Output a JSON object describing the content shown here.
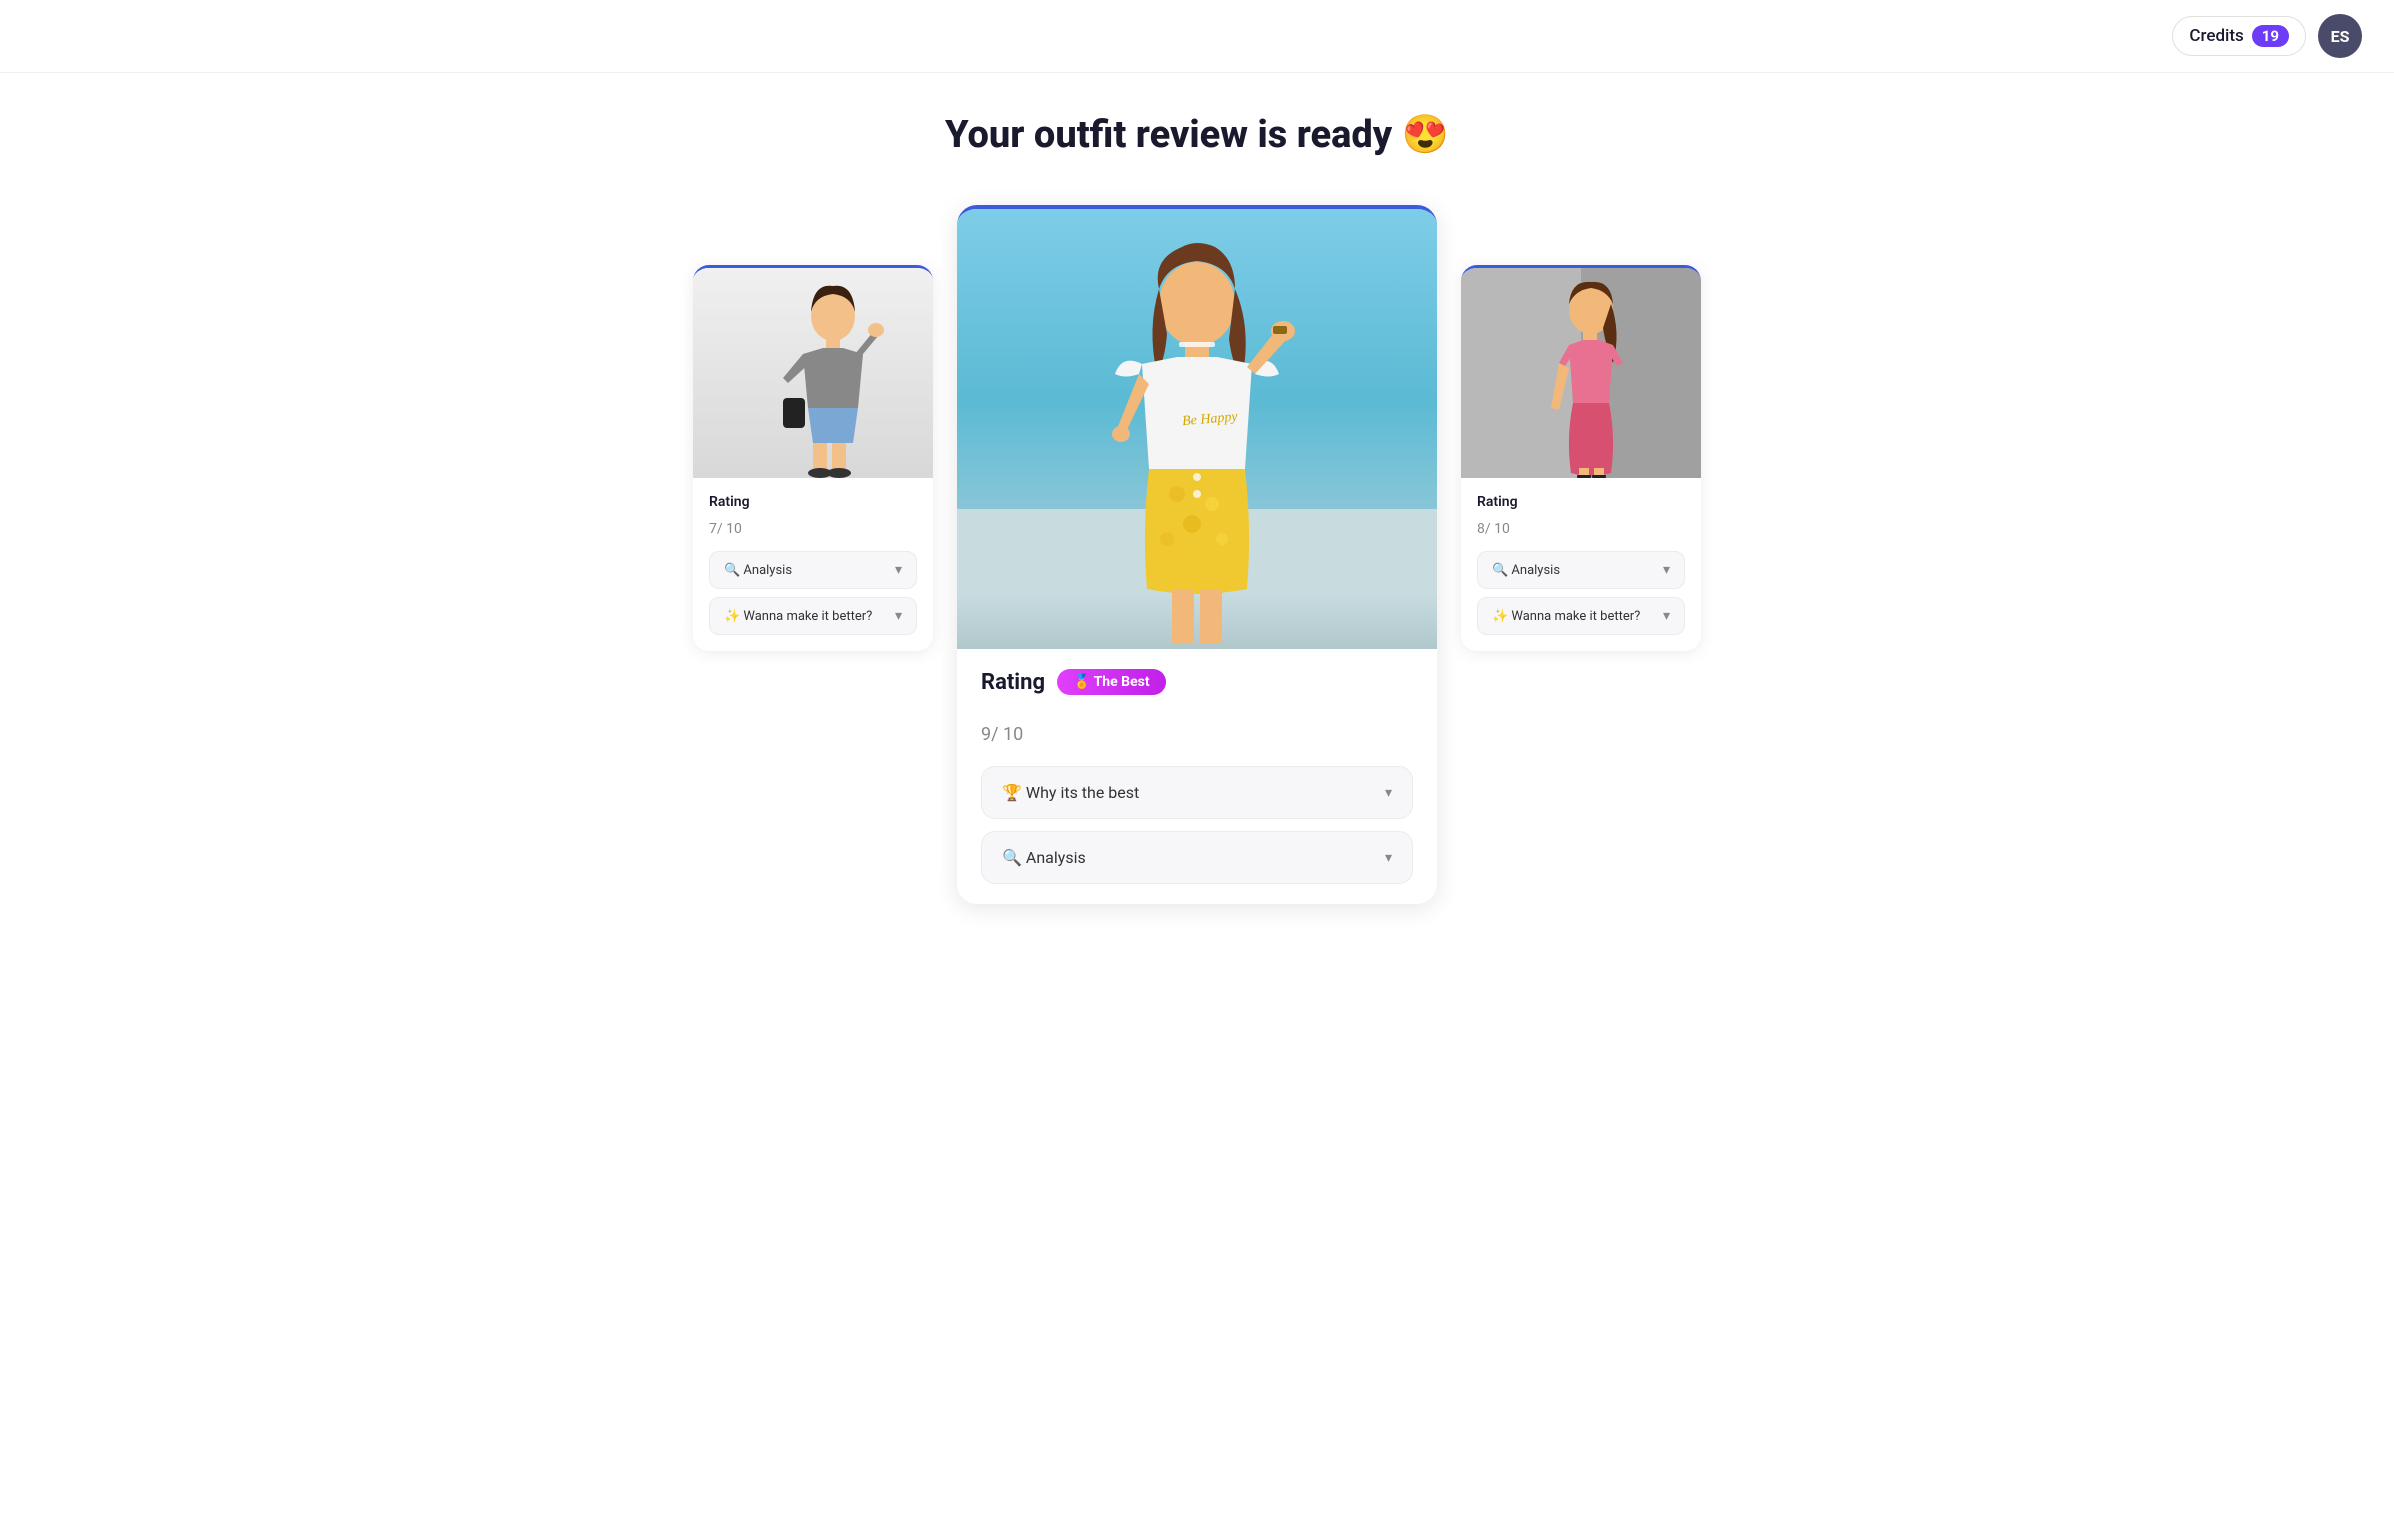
{
  "header": {
    "credits_label": "Credits",
    "credits_count": "19",
    "avatar_initials": "ES"
  },
  "page": {
    "title": "Your outfit review is ready 😍"
  },
  "cards": [
    {
      "id": "left",
      "rating_label": "Rating",
      "score": "7",
      "score_max": "/ 10",
      "dropdowns": [
        {
          "label": "🔍 Analysis",
          "id": "analysis"
        },
        {
          "label": "✨ Wanna make it better?",
          "id": "improve"
        }
      ],
      "image_emoji": "👗"
    },
    {
      "id": "center",
      "rating_label": "Rating",
      "best_badge": "🏅 The Best",
      "score": "9",
      "score_max": "/ 10",
      "dropdowns": [
        {
          "label": "🏆 Why its the best",
          "id": "why-best"
        },
        {
          "label": "🔍 Analysis",
          "id": "analysis"
        }
      ],
      "image_emoji": "👩"
    },
    {
      "id": "right",
      "rating_label": "Rating",
      "score": "8",
      "score_max": "/ 10",
      "dropdowns": [
        {
          "label": "🔍 Analysis",
          "id": "analysis"
        },
        {
          "label": "✨ Wanna make it better?",
          "id": "improve"
        }
      ],
      "image_emoji": "👗"
    }
  ]
}
